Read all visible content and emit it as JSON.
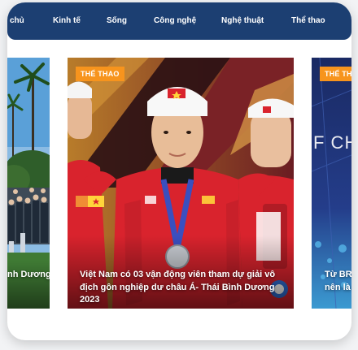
{
  "nav": {
    "items": [
      {
        "label": "chủ"
      },
      {
        "label": "Kinh tế"
      },
      {
        "label": "Sống"
      },
      {
        "label": "Công nghệ"
      },
      {
        "label": "Nghệ thuật"
      },
      {
        "label": "Thể thao"
      }
    ]
  },
  "slides": {
    "left": {
      "caption": "nh Dương"
    },
    "center": {
      "category": "THỂ THAO",
      "caption": "Việt Nam có 03 vận động viên tham dự giải vô địch gôn nghiệp dư châu Á- Thái Bình Dương 2023"
    },
    "right": {
      "category": "THỂ TH",
      "bg_text": "F CH",
      "caption_line1": "Từ BR",
      "caption_line2": "nên là"
    }
  },
  "colors": {
    "navbar": "#1c3f72",
    "badge": "#f7941d",
    "jersey": "#d9232d"
  }
}
